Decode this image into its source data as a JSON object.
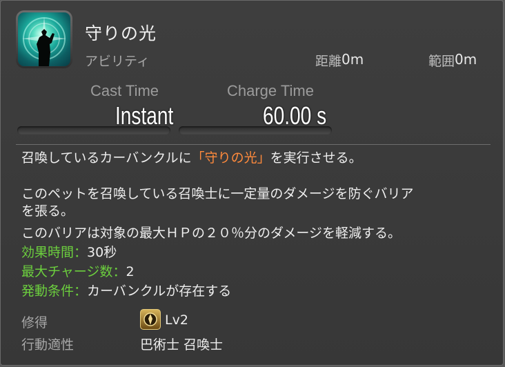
{
  "action": {
    "name": "守りの光",
    "category": "アビリティ",
    "range_label": "距離",
    "range_value": "0m",
    "radius_label": "範囲",
    "radius_value": "0m"
  },
  "stats": {
    "cast_label": "Cast Time",
    "cast_value": "Instant",
    "recast_label": "Charge Time",
    "recast_value": "60.00 s"
  },
  "description": {
    "line1_pre": "召喚しているカーバンクルに",
    "line1_highlight": "「守りの光」",
    "line1_post": "を実行させる。",
    "line2": "このペットを召喚している召喚士に一定量のダメージを防ぐバリア",
    "line3": "を張る。",
    "line4": "このバリアは対象の最大ＨＰの２０％分のダメージを軽減する。",
    "effects": [
      {
        "label": "効果時間",
        "sep": "：",
        "value": "30秒"
      },
      {
        "label": "最大チャージ数",
        "sep": "：",
        "value": "2"
      },
      {
        "label": "発動条件",
        "sep": "：",
        "value": "カーバンクルが存在する"
      }
    ]
  },
  "acquire": {
    "label": "修得",
    "icon": "job-crystal-icon",
    "level": "Lv2"
  },
  "affinity": {
    "label": "行動適性",
    "value": "巴術士 召喚士"
  },
  "colors": {
    "highlight": "#ff8a3c",
    "effect_label": "#6ccf3e",
    "level": "#6ccf3e"
  }
}
